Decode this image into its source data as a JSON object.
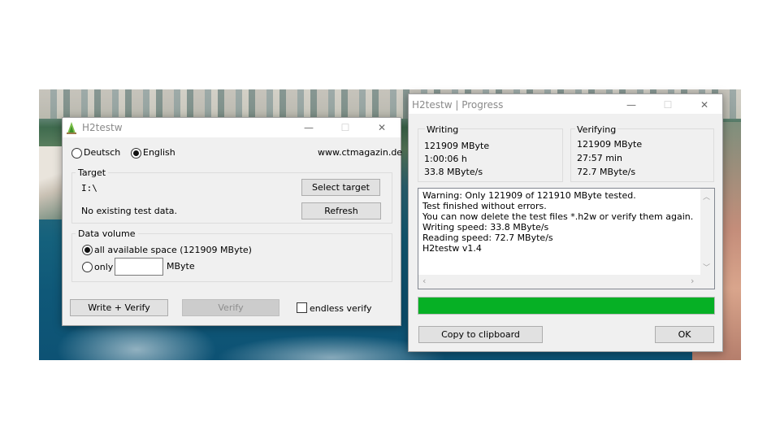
{
  "main_window": {
    "title": "H2testw",
    "lang_deutsch": "Deutsch",
    "lang_english": "English",
    "selected_language": "English",
    "website": "www.ctmagazin.de",
    "target": {
      "group_label": "Target",
      "path": "I:\\",
      "status": "No existing test data.",
      "select_button": "Select target",
      "refresh_button": "Refresh"
    },
    "data_volume": {
      "group_label": "Data volume",
      "all_space_label": "all available space (121909 MByte)",
      "only_label": "only",
      "only_value": "",
      "unit": "MByte",
      "selected": "all available space"
    },
    "write_verify_button": "Write + Verify",
    "verify_button": "Verify",
    "endless_verify_label": "endless verify",
    "endless_verify_checked": false
  },
  "progress_window": {
    "title": "H2testw | Progress",
    "writing": {
      "label": "Writing",
      "size": "121909 MByte",
      "time": "1:00:06 h",
      "speed": "33.8 MByte/s"
    },
    "verifying": {
      "label": "Verifying",
      "size": "121909 MByte",
      "time": "27:57 min",
      "speed": "72.7 MByte/s"
    },
    "log": [
      "Warning: Only 121909 of 121910 MByte tested.",
      "Test finished without errors.",
      "You can now delete the test files *.h2w or verify them again.",
      "Writing speed: 33.8 MByte/s",
      "Reading speed: 72.7 MByte/s",
      "H2testw v1.4"
    ],
    "progress_fraction": 1.0,
    "progress_color": "#06b025",
    "copy_button": "Copy to clipboard",
    "ok_button": "OK"
  },
  "window_controls": {
    "minimize": "—",
    "maximize": "☐",
    "close": "✕"
  },
  "icons": {
    "app_icon": "h2testw-app-icon",
    "scroll_up": "chevron-up-icon",
    "scroll_down": "chevron-down-icon",
    "scroll_left": "chevron-left-icon",
    "scroll_right": "chevron-right-icon"
  }
}
